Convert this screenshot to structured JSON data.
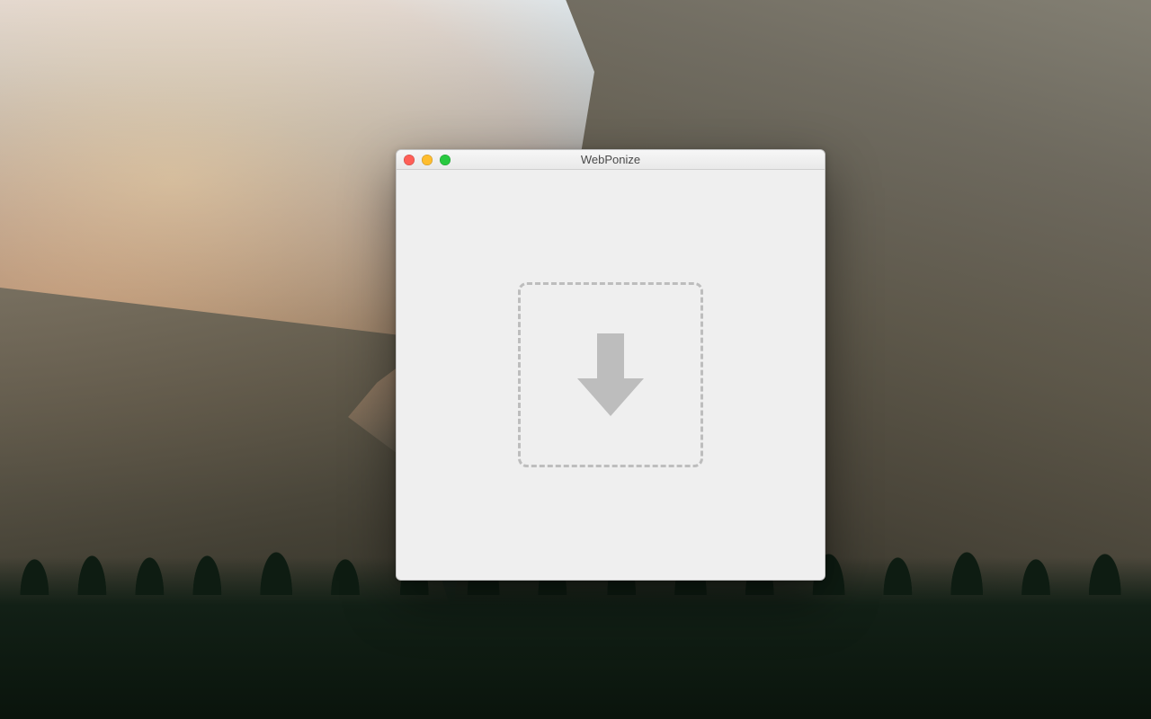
{
  "window": {
    "title": "WebPonize"
  },
  "icons": {
    "drop_arrow": "arrow-down-icon"
  },
  "colors": {
    "window_bg": "#efefef",
    "dashed_border": "#bdbdbd",
    "arrow_fill": "#bdbdbd",
    "close": "#ff5f57",
    "minimize": "#ffbd2e",
    "zoom": "#28c940"
  }
}
